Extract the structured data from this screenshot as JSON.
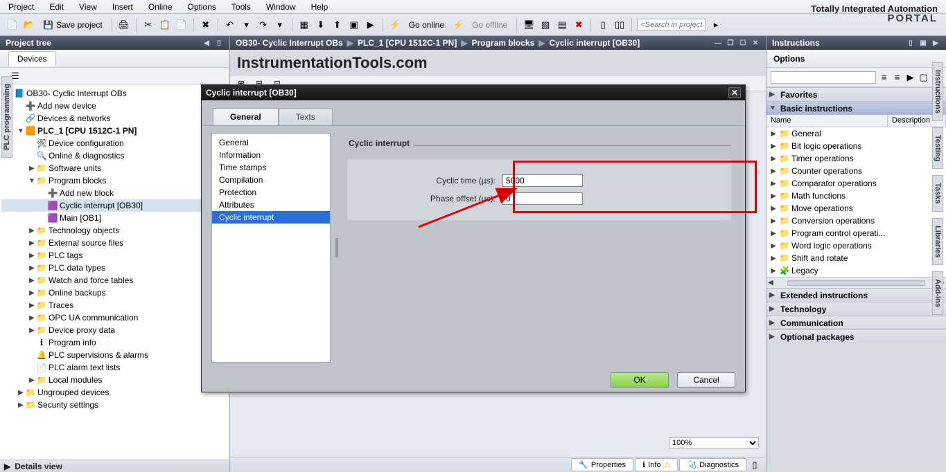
{
  "menu": {
    "items": [
      "Project",
      "Edit",
      "View",
      "Insert",
      "Online",
      "Options",
      "Tools",
      "Window",
      "Help"
    ]
  },
  "brand": {
    "line1": "Totally Integrated Automation",
    "line2": "PORTAL"
  },
  "toolbar": {
    "save_label": "Save project",
    "go_online": "Go online",
    "go_offline": "Go offline",
    "search_placeholder": "<Search in project>"
  },
  "left": {
    "panel_title": "Project tree",
    "devices_tab": "Devices",
    "tree": [
      {
        "lvl": 0,
        "caret": "down",
        "icon": "project",
        "label": "OB30- Cyclic Interrupt OBs"
      },
      {
        "lvl": 1,
        "caret": "",
        "icon": "add",
        "label": "Add new device"
      },
      {
        "lvl": 1,
        "caret": "",
        "icon": "net",
        "label": "Devices & networks"
      },
      {
        "lvl": 1,
        "caret": "down",
        "icon": "plc",
        "label": "PLC_1 [CPU 1512C-1 PN]",
        "bold": true
      },
      {
        "lvl": 2,
        "caret": "",
        "icon": "devcfg",
        "label": "Device configuration"
      },
      {
        "lvl": 2,
        "caret": "",
        "icon": "diag",
        "label": "Online & diagnostics"
      },
      {
        "lvl": 2,
        "caret": "right",
        "icon": "folder",
        "label": "Software units"
      },
      {
        "lvl": 2,
        "caret": "down",
        "icon": "folder",
        "label": "Program blocks"
      },
      {
        "lvl": 3,
        "caret": "",
        "icon": "add",
        "label": "Add new block"
      },
      {
        "lvl": 3,
        "caret": "",
        "icon": "ob",
        "label": "Cyclic interrupt [OB30]",
        "sel": true
      },
      {
        "lvl": 3,
        "caret": "",
        "icon": "ob",
        "label": "Main [OB1]"
      },
      {
        "lvl": 2,
        "caret": "right",
        "icon": "folder",
        "label": "Technology objects"
      },
      {
        "lvl": 2,
        "caret": "right",
        "icon": "folder",
        "label": "External source files"
      },
      {
        "lvl": 2,
        "caret": "right",
        "icon": "folder",
        "label": "PLC tags"
      },
      {
        "lvl": 2,
        "caret": "right",
        "icon": "folder",
        "label": "PLC data types"
      },
      {
        "lvl": 2,
        "caret": "right",
        "icon": "folder",
        "label": "Watch and force tables"
      },
      {
        "lvl": 2,
        "caret": "right",
        "icon": "folder",
        "label": "Online backups"
      },
      {
        "lvl": 2,
        "caret": "right",
        "icon": "folder",
        "label": "Traces"
      },
      {
        "lvl": 2,
        "caret": "right",
        "icon": "folder",
        "label": "OPC UA communication"
      },
      {
        "lvl": 2,
        "caret": "right",
        "icon": "folder",
        "label": "Device proxy data"
      },
      {
        "lvl": 2,
        "caret": "",
        "icon": "info",
        "label": "Program info"
      },
      {
        "lvl": 2,
        "caret": "",
        "icon": "sup",
        "label": "PLC supervisions & alarms"
      },
      {
        "lvl": 2,
        "caret": "",
        "icon": "txt",
        "label": "PLC alarm text lists"
      },
      {
        "lvl": 2,
        "caret": "right",
        "icon": "folder",
        "label": "Local modules"
      },
      {
        "lvl": 1,
        "caret": "right",
        "icon": "folder",
        "label": "Ungrouped devices"
      },
      {
        "lvl": 1,
        "caret": "right",
        "icon": "folder",
        "label": "Security settings"
      }
    ],
    "details_label": "Details view",
    "side_tab": "PLC programming"
  },
  "center": {
    "breadcrumbs": [
      "OB30- Cyclic Interrupt OBs",
      "PLC_1 [CPU 1512C-1 PN]",
      "Program blocks",
      "Cyclic interrupt [OB30]"
    ],
    "watermark": "InstrumentationTools.com",
    "zoom": "100%",
    "bottom_tabs": [
      {
        "icon": "prop",
        "label": "Properties"
      },
      {
        "icon": "info",
        "label": "Info"
      },
      {
        "icon": "diag",
        "label": "Diagnostics"
      }
    ]
  },
  "right": {
    "panel_title": "Instructions",
    "options_label": "Options",
    "categories": [
      "Favorites",
      "Basic instructions",
      "Extended instructions",
      "Technology",
      "Communication",
      "Optional packages"
    ],
    "cols": {
      "name": "Name",
      "desc": "Description"
    },
    "basic": [
      "General",
      "Bit logic operations",
      "Timer operations",
      "Counter operations",
      "Comparator operations",
      "Math functions",
      "Move operations",
      "Conversion operations",
      "Program control operati...",
      "Word logic operations",
      "Shift and rotate",
      "Legacy"
    ],
    "side_tabs": [
      "Instructions",
      "Testing",
      "Tasks",
      "Libraries",
      "Add-ins"
    ]
  },
  "dialog": {
    "title": "Cyclic interrupt [OB30]",
    "tab_general": "General",
    "tab_texts": "Texts",
    "nav": [
      "General",
      "Information",
      "Time stamps",
      "Compilation",
      "Protection",
      "Attributes",
      "Cyclic interrupt"
    ],
    "section_title": "Cyclic interrupt",
    "cyclic_label": "Cyclic time (µs):",
    "cyclic_value": "5000",
    "phase_label": "Phase offset (µs):",
    "phase_value": "0",
    "ok": "OK",
    "cancel": "Cancel"
  }
}
